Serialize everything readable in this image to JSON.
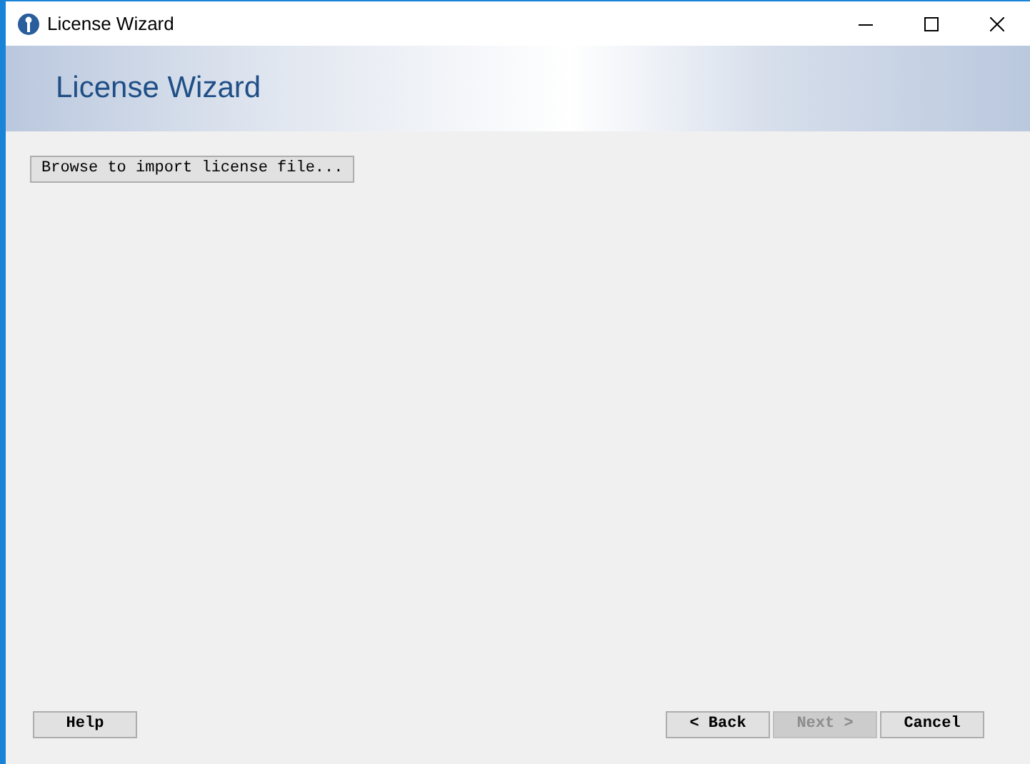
{
  "window": {
    "title": "License Wizard"
  },
  "header": {
    "title": "License Wizard"
  },
  "import_button": {
    "label": "Browse to import license file..."
  },
  "buttons": [
    {
      "label": "Help",
      "disabled": false,
      "kind": "left"
    },
    {
      "label": "< Back",
      "disabled": false,
      "kind": "right"
    },
    {
      "label": "Next >",
      "disabled": true,
      "kind": "right"
    },
    {
      "label": "Cancel",
      "disabled": false,
      "kind": "right"
    }
  ]
}
